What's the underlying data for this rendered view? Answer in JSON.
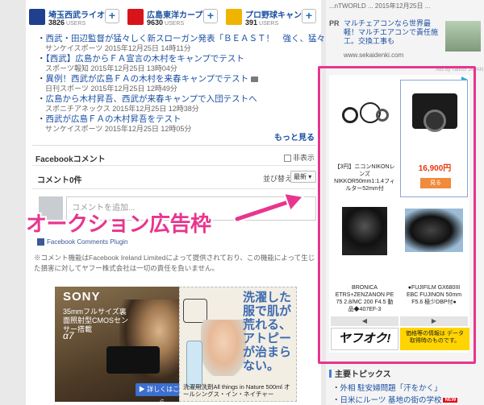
{
  "teams": [
    {
      "name": "埼玉西武ライオ...",
      "count": "3826",
      "users": "USERS",
      "color": "#1f3f8f"
    },
    {
      "name": "広島東洋カープ",
      "count": "9630",
      "users": "USERS",
      "color": "#d7141a"
    },
    {
      "name": "プロ野球キャン...",
      "count": "391",
      "users": "USERS",
      "color": "#f0b400"
    }
  ],
  "news": [
    {
      "title": "西武・田辺監督が猛々しく新スローガン発表「ＢＥＡＳＴ！　強く、猛々しく。」",
      "source": "サンケイスポーツ 2015年12月25日 14時11分",
      "photo": false
    },
    {
      "title": "【西武】広島からＦＡ宣言の木村をキャンプでテスト",
      "source": "スポーツ報知 2015年12月25日 13時04分",
      "photo": false
    },
    {
      "title": "異例！西武が広島ＦＡの木村を来春キャンプでテスト",
      "source": "日刊スポーツ 2015年12月25日 12時49分",
      "photo": true
    },
    {
      "title": "広島から木村昇吾、西武が来春キャンプで入団テストへ",
      "source": "スポニチアネックス 2015年12月25日 12時38分",
      "photo": false
    },
    {
      "title": "西武が広島ＦＡの木村昇吾をテスト",
      "source": "サンケイスポーツ 2015年12月25日 12時05分",
      "photo": false
    }
  ],
  "more_label": "もっと見る",
  "facebook": {
    "title": "Facebookコメント",
    "hide_label": "非表示",
    "comment_count": "コメント0件",
    "sort_label": "並び替え",
    "sort_value": "最新 ▾",
    "input_placeholder": "コメントを追加...",
    "plugin_label": "Facebook Comments Plugin",
    "notice": "※コメント機能はFacebook Ireland Limitedによって提供されており、この機能によって生じた損害に対してヤフー株式会社は一切の責任を負いません。"
  },
  "ad_sony": {
    "brand": "SONY",
    "copy": "35mmフルサイズ裏面照射型CMOSセンサー搭載",
    "model": "α7",
    "detail_label": "▶ 詳しくはこちら"
  },
  "ad_detergent": {
    "headline": "洗濯した服で肌が荒れる、アトピーが治まらない。",
    "caption": "洗濯用洗剤All things in Nature 500ml オールシングス・イン・ネイチャー"
  },
  "pr": {
    "top_line": "...nTWORLD ... 2015年12月25日 ...",
    "tag": "PR",
    "text": "マルチェアコンなら世界最軽！マルチエアコンで責任施工。交換工事も",
    "url": "www.sekaidenki.com",
    "ads_by": "Ads by Yahoo! JAPAN"
  },
  "auction": {
    "items": [
      {
        "title": "【3円】ニコンNIKONレンズ NIKKOR50mm1:1.4フィルター52mm付"
      },
      {
        "price": "16,900円",
        "view_label": "見る"
      },
      {
        "title": "BRONICA ETRS+ZENZANON PE 75 2.8/MC 200 F4.5 動品◆407EF-3"
      },
      {
        "title": "●FUJIFILM GX680III EBC FUJINON 50mm F5.6 極少DBP付●"
      }
    ],
    "prev_label": "◀",
    "next_label": "▶",
    "logo": "ヤフオク!",
    "info": "価格等の情報は データ取得時のものです。"
  },
  "main_topics": {
    "heading": "主要トピックス",
    "items": [
      {
        "title": "外相 駐安婦問題「汗をかく」",
        "badge": ""
      },
      {
        "title": "日米にルーツ 基地の街の学校",
        "badge": "NEW"
      }
    ]
  },
  "annotation": "オークション広告枠",
  "colors": {
    "highlight": "#e8358e",
    "link": "#1a4fa3"
  }
}
